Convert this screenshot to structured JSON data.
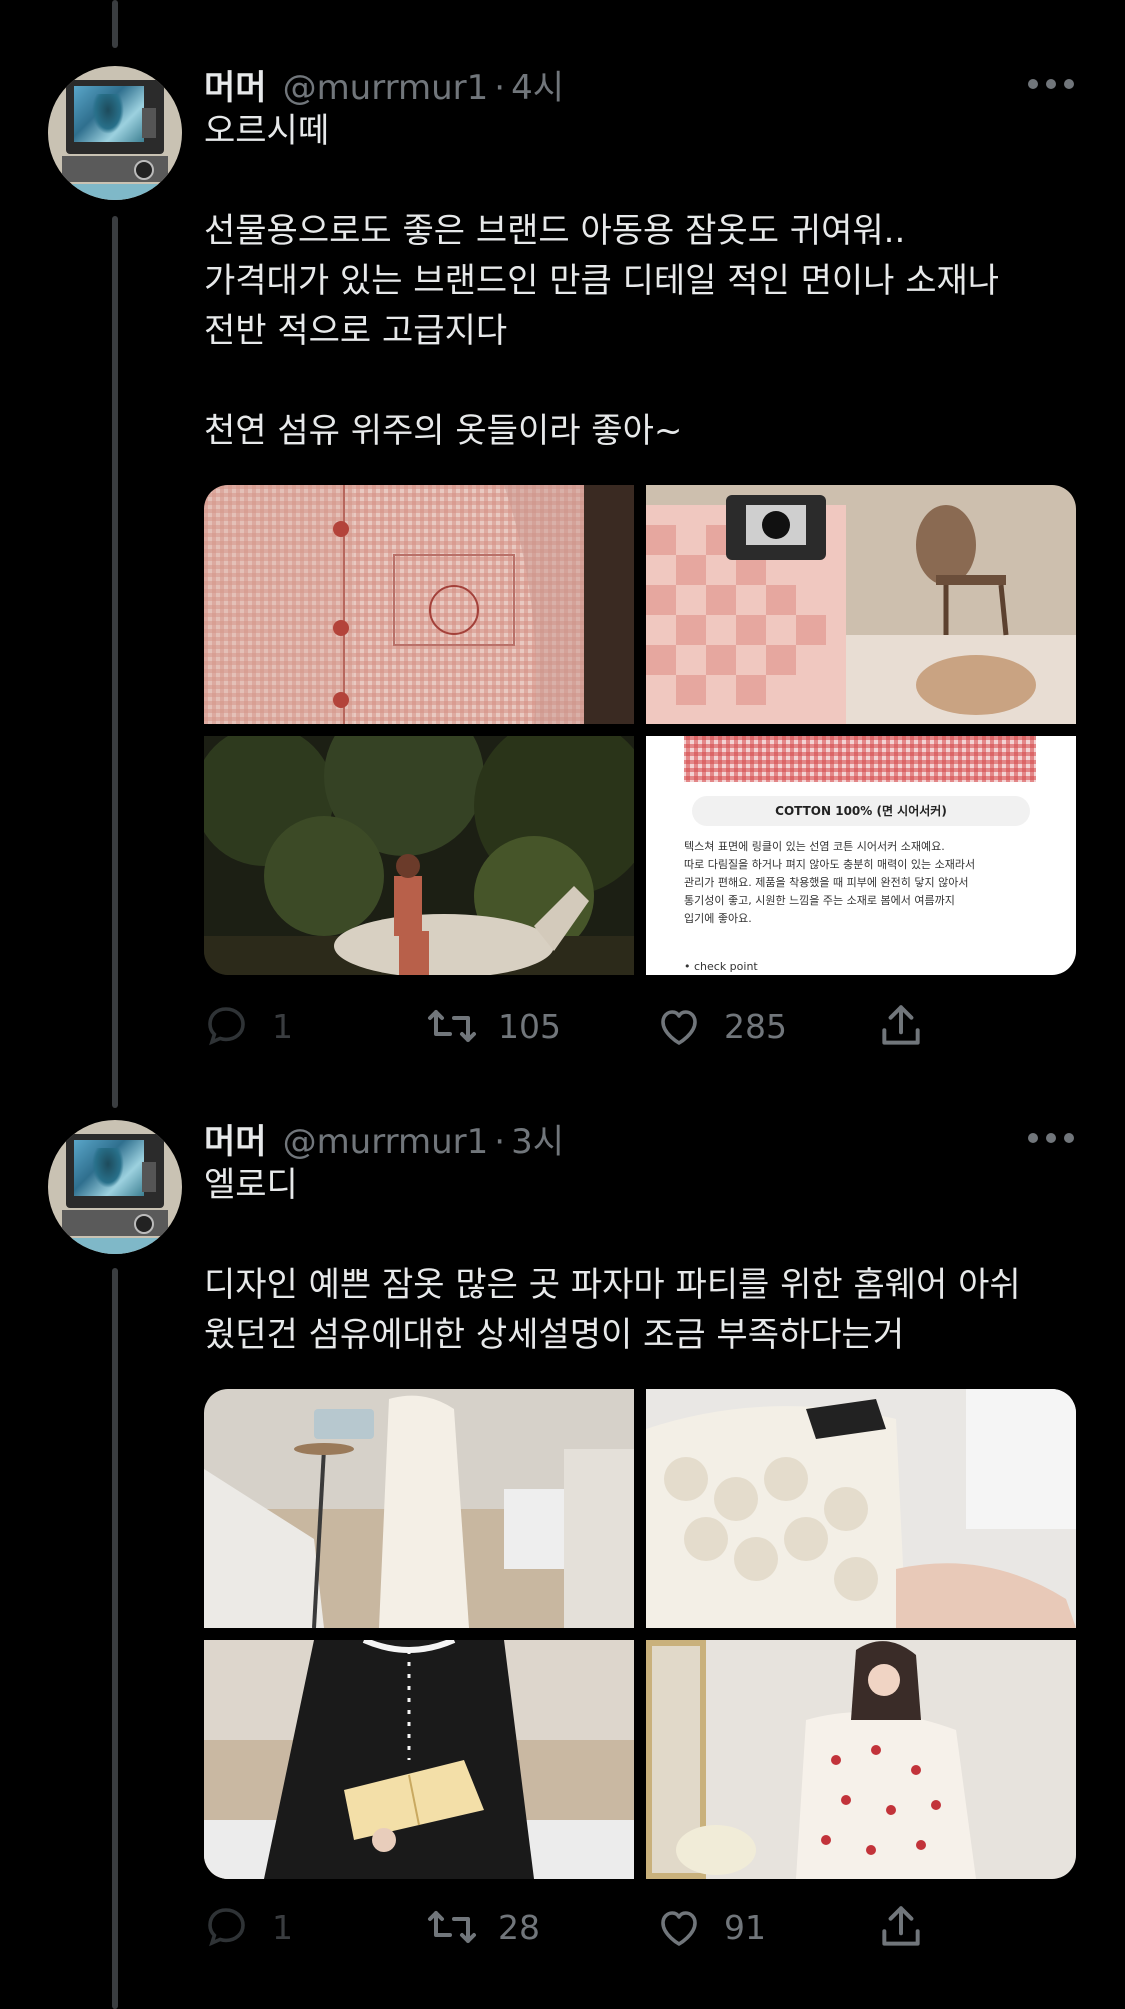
{
  "tweets": [
    {
      "display_name": "머머",
      "handle": "@murrmur1",
      "separator": "·",
      "time": "4시",
      "paragraphs": [
        "오르시떼",
        "",
        "선물용으로도 좋은 브랜드 아동용 잠옷도 귀여워..",
        "가격대가 있는 브랜드인 만큼 디테일 적인 면이나 소재나",
        "전반 적으로 고급지다",
        "",
        "천연 섬유 위주의 옷들이라 좋아~"
      ],
      "image4_card": {
        "title": "COTTON 100% (면 시어서커)",
        "body_lines": [
          "텍스쳐 표면에 링클이 있는 선염 코튼 시어서커 소재예요.",
          "따로 다림질을 하거나 펴지 않아도 충분히 매력이 있는 소재라서",
          "관리가 편해요. 제품을 착용했을 때 피부에 완전히 닿지 않아서",
          "통기성이 좋고, 시원한 느낌을 주는 소재로 봄에서 여름까지",
          "입기에 좋아요."
        ],
        "footer": "• check point"
      },
      "replies": "1",
      "retweets": "105",
      "likes": "285"
    },
    {
      "display_name": "머머",
      "handle": "@murrmur1",
      "separator": "·",
      "time": "3시",
      "paragraphs": [
        "엘로디",
        "",
        "디자인 예쁜 잠옷 많은 곳 파자마 파티를 위한 홈웨어 아쉬",
        "웠던건 섬유에대한 상세설명이 조금 부족하다는거"
      ],
      "replies": "1",
      "retweets": "28",
      "likes": "91"
    }
  ],
  "colors": {
    "background": "#000000",
    "text_primary": "#e7e9ea",
    "text_secondary": "#71767b",
    "thread_line": "#3a3d40"
  },
  "icons": [
    "more-icon",
    "reply-icon",
    "retweet-icon",
    "like-icon",
    "share-icon"
  ]
}
